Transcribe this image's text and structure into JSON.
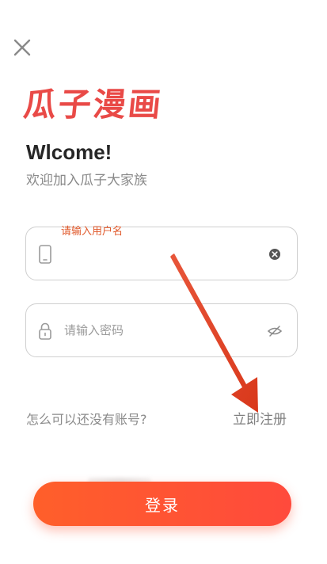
{
  "header": {
    "close_icon": "close-icon",
    "logo_text": "瓜子漫画"
  },
  "intro": {
    "welcome": "Wlcome!",
    "subtitle": "欢迎加入瓜子大家族"
  },
  "username_field": {
    "floating_label": "请输入用户名",
    "leading_icon": "phone-icon",
    "trailing_icon": "clear-icon"
  },
  "password_field": {
    "placeholder": "请输入密码",
    "leading_icon": "lock-icon",
    "trailing_icon": "eye-hidden-icon"
  },
  "account": {
    "prompt": "怎么可以还没有账号?",
    "register_label": "立即注册"
  },
  "login": {
    "label": "登录"
  },
  "colors": {
    "brand_red": "#e94a47",
    "button_gradient_start": "#ff5f2a",
    "button_gradient_end": "#ff4a3c",
    "annotation_arrow": "#e0401f",
    "label_orange": "#e0582a"
  }
}
